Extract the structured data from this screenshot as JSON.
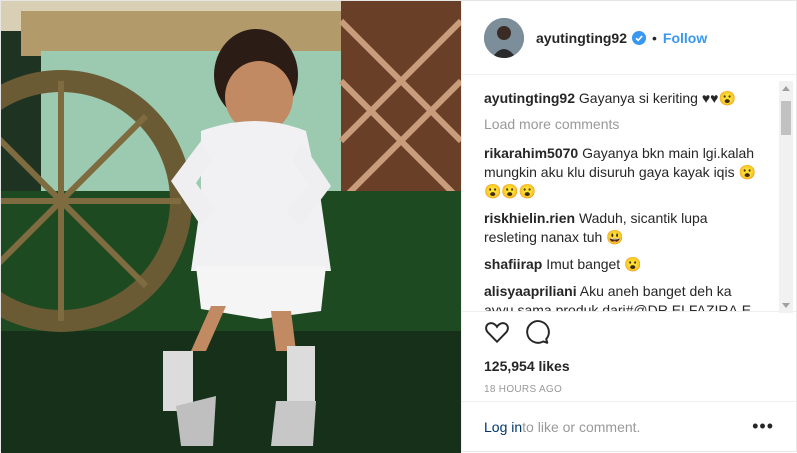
{
  "post": {
    "username": "ayutingting92",
    "follow_label": "Follow",
    "dot": "•",
    "caption": {
      "user": "ayutingting92",
      "text": "Gayanya si keriting ♥♥😮"
    },
    "load_more": "Load more comments",
    "comments": [
      {
        "user": "rikarahim5070",
        "text": "Gayanya bkn main lgi.kalah mungkin aku klu disuruh gaya kayak iqis 😮😮😮😮"
      },
      {
        "user": "riskhielin.rien",
        "text": "Waduh, sicantik lupa resleting nanax tuh 😃"
      },
      {
        "user": "shafiirap",
        "text": "Imut banget 😮"
      },
      {
        "user": "alisyaapriliani",
        "text": "Aku aneh banget deh ka ayyu sama produk dari#@DR.ELFAZIRA.E"
      }
    ],
    "likes": "125,954 likes",
    "timestamp": "18 HOURS AGO",
    "footer": {
      "login": "Log in",
      "rest": " to like or comment.",
      "more": "•••"
    },
    "icons": {
      "like": "heart-icon",
      "comment": "comment-icon",
      "verified": "verified-badge-icon"
    },
    "colors": {
      "follow": "#3897f0",
      "verified": "#3897f0"
    }
  }
}
